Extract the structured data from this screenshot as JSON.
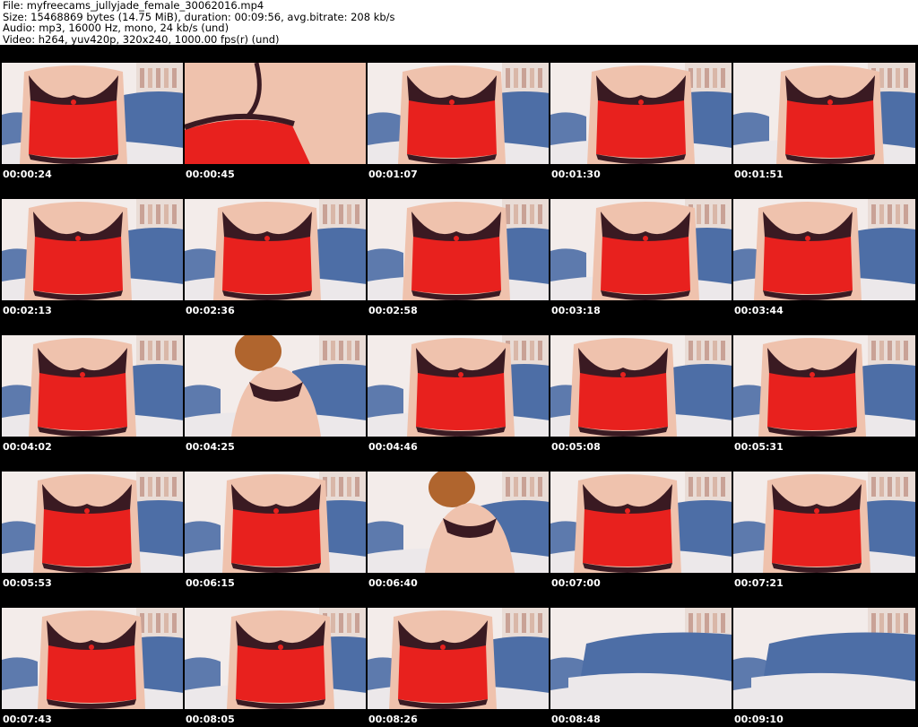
{
  "header": {
    "file_line": "File: myfreecams_jullyjade_female_30062016.mp4",
    "size_line": "Size: 15468869 bytes (14.75 MiB), duration: 00:09:56, avg.bitrate: 208 kb/s",
    "audio_line": "Audio: mp3, 16000 Hz, mono, 24 kb/s (und)",
    "video_line": "Video: h264, yuv420p, 320x240, 1000.00 fps(r) (und)"
  },
  "thumbnails": [
    {
      "timestamp": "00:00:24",
      "scene": "torso"
    },
    {
      "timestamp": "00:00:45",
      "scene": "closeup"
    },
    {
      "timestamp": "00:01:07",
      "scene": "torso"
    },
    {
      "timestamp": "00:01:30",
      "scene": "torso"
    },
    {
      "timestamp": "00:01:51",
      "scene": "torso"
    },
    {
      "timestamp": "00:02:13",
      "scene": "torso"
    },
    {
      "timestamp": "00:02:36",
      "scene": "torso"
    },
    {
      "timestamp": "00:02:58",
      "scene": "torso"
    },
    {
      "timestamp": "00:03:18",
      "scene": "torso"
    },
    {
      "timestamp": "00:03:44",
      "scene": "torso"
    },
    {
      "timestamp": "00:04:02",
      "scene": "torso"
    },
    {
      "timestamp": "00:04:25",
      "scene": "leaning"
    },
    {
      "timestamp": "00:04:46",
      "scene": "torso"
    },
    {
      "timestamp": "00:05:08",
      "scene": "torso"
    },
    {
      "timestamp": "00:05:31",
      "scene": "torso"
    },
    {
      "timestamp": "00:05:53",
      "scene": "torso"
    },
    {
      "timestamp": "00:06:15",
      "scene": "torso"
    },
    {
      "timestamp": "00:06:40",
      "scene": "leaning"
    },
    {
      "timestamp": "00:07:00",
      "scene": "torso"
    },
    {
      "timestamp": "00:07:21",
      "scene": "torso"
    },
    {
      "timestamp": "00:07:43",
      "scene": "torso"
    },
    {
      "timestamp": "00:08:05",
      "scene": "torso"
    },
    {
      "timestamp": "00:08:26",
      "scene": "torso"
    },
    {
      "timestamp": "00:08:48",
      "scene": "empty-couch"
    },
    {
      "timestamp": "00:09:10",
      "scene": "empty-couch"
    }
  ],
  "colors": {
    "sheet_background": "#000000",
    "timestamp_text": "#ffffff",
    "wall": "#f3ecea",
    "couch": "#4d6ea6",
    "garment": "#e8211e",
    "lace": "#3a1a22",
    "skin": "#efc2ad",
    "hair": "#b0652e",
    "blanket": "#ece8ea"
  }
}
